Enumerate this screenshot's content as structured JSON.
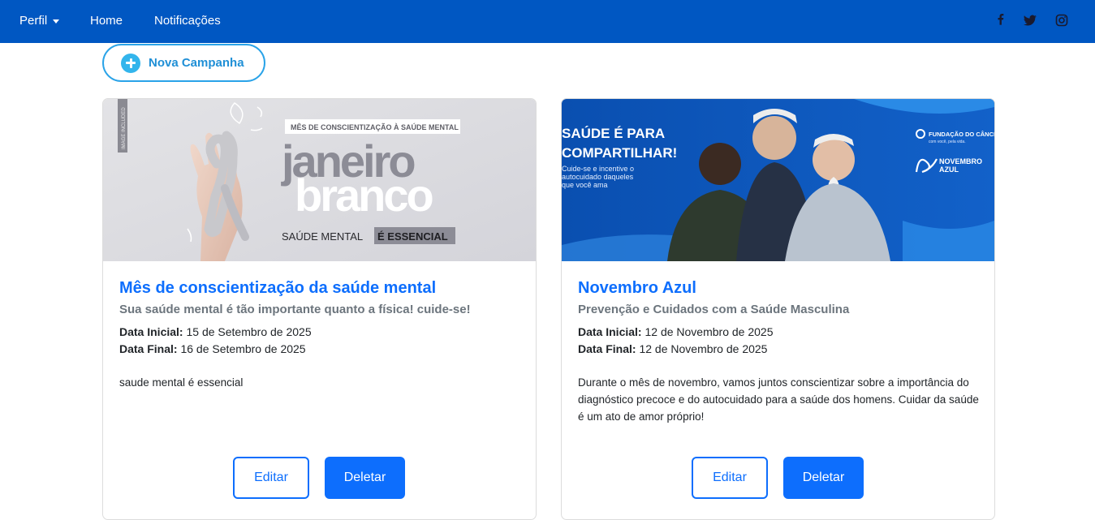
{
  "nav": {
    "perfil": "Perfil",
    "home": "Home",
    "notificacoes": "Notificações",
    "social_icons": [
      "facebook-icon",
      "twitter-icon",
      "instagram-icon"
    ]
  },
  "actions": {
    "new_campaign": "Nova Campanha"
  },
  "campaigns": [
    {
      "banner": {
        "tag": "MÊS DE CONSCIENTIZAÇÃO À SAÚDE MENTAL",
        "word1": "janeiro",
        "word2": "branco",
        "tagline_a": "SAÚDE MENTAL",
        "tagline_b": "É ESSENCIAL",
        "side": "IMAGE INCLUDED"
      },
      "title": "Mês de conscientização da saúde mental",
      "subtitle": "Sua saúde mental é tão importante quanto a física! cuide-se!",
      "start_label": "Data Inicial:",
      "start_value": "15 de Setembro de 2025",
      "end_label": "Data Final:",
      "end_value": "16 de Setembro de 2025",
      "description": "saude mental é essencial",
      "edit_label": "Editar",
      "delete_label": "Deletar"
    },
    {
      "banner": {
        "headline1": "SAÚDE É PARA",
        "headline2": "COMPARTILHAR!",
        "body1": "Cuide-se e incentive o",
        "body2": "autocuidado daqueles",
        "body3": "que você ama",
        "brand1": "FUNDAÇÃO DO CÂNCER",
        "brand1_sub": "com você, pela vida.",
        "brand2a": "NOVEMBRO",
        "brand2b": "AZUL"
      },
      "title": "Novembro Azul",
      "subtitle": "Prevenção e Cuidados com a Saúde Masculina",
      "start_label": "Data Inicial:",
      "start_value": "12 de Novembro de 2025",
      "end_label": "Data Final:",
      "end_value": "12 de Novembro de 2025",
      "description": "Durante o mês de novembro, vamos juntos conscientizar sobre a importância do diagnóstico precoce e do autocuidado para a saúde dos homens. Cuidar da saúde é um ato de amor próprio!",
      "edit_label": "Editar",
      "delete_label": "Deletar"
    }
  ],
  "colors": {
    "navbar": "#0057c2",
    "primary": "#0d6efd",
    "accent": "#2aa3e8"
  }
}
